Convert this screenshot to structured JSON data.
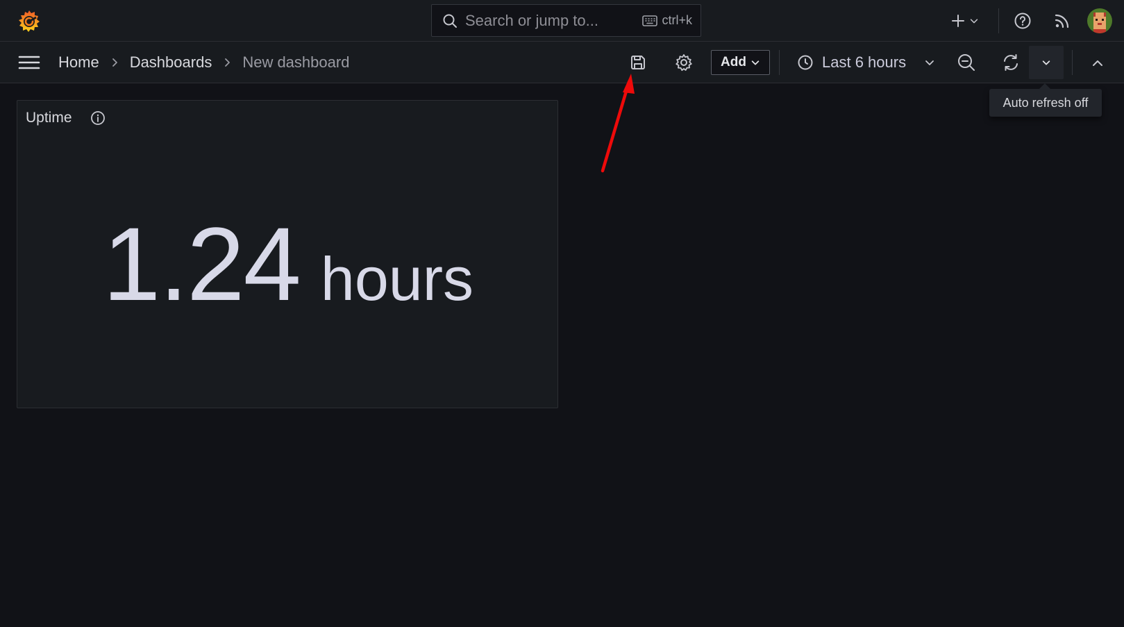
{
  "search": {
    "placeholder": "Search or jump to...",
    "shortcut": "ctrl+k"
  },
  "breadcrumb": {
    "items": [
      {
        "label": "Home"
      },
      {
        "label": "Dashboards"
      },
      {
        "label": "New dashboard"
      }
    ]
  },
  "toolbar": {
    "add_label": "Add",
    "time_range": "Last 6 hours",
    "refresh_tooltip": "Auto refresh off"
  },
  "panel": {
    "title": "Uptime",
    "value": "1.24",
    "unit": "hours"
  },
  "icons": {
    "logo": "grafana-logo-icon",
    "search": "search-icon",
    "keyboard": "keyboard-icon",
    "new": "plus-icon",
    "help": "help-circle-icon",
    "news": "rss-icon",
    "menu": "hamburger-menu-icon",
    "save": "save-icon",
    "settings": "gear-icon",
    "time": "clock-icon",
    "zoom_out": "zoom-out-icon",
    "refresh": "refresh-icon",
    "collapse": "chevron-up-icon",
    "info": "info-icon"
  },
  "colors": {
    "page_bg": "#111217",
    "bar_bg": "#181b1f",
    "brand_orange": "#f46800",
    "annotation_arrow": "#ee0a0a"
  }
}
